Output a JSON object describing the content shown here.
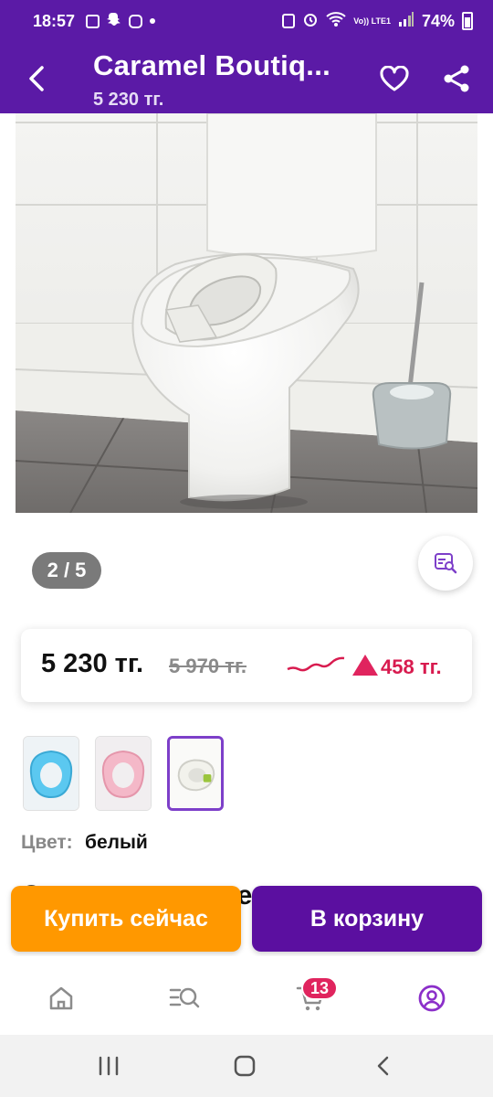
{
  "status_bar": {
    "time": "18:57",
    "battery": "74%",
    "network": "Vo)) LTE1"
  },
  "header": {
    "title": "Caramel Boutiq...",
    "price": "5 230 тг."
  },
  "gallery": {
    "counter": "2 / 5"
  },
  "price_card": {
    "current": "5 230 тг.",
    "old": "5 970 тг.",
    "drop": "458 тг."
  },
  "variants": {
    "items": [
      {
        "name": "blue",
        "color": "#5bc8f0"
      },
      {
        "name": "pink",
        "color": "#f4b8c8"
      },
      {
        "name": "white",
        "color": "#f2f2ec"
      }
    ],
    "selected": 2,
    "color_label": "Цвет:",
    "color_value": "белый"
  },
  "description": {
    "heading_partial": "Сидение детское - накладка на"
  },
  "actions": {
    "buy_now": "Купить сейчас",
    "add_to_cart": "В корзину"
  },
  "bottom_nav": {
    "cart_count": "13"
  },
  "colors": {
    "brand": "#5b1aa6",
    "orange": "#ff9800",
    "price_drop": "#d81b4f"
  }
}
